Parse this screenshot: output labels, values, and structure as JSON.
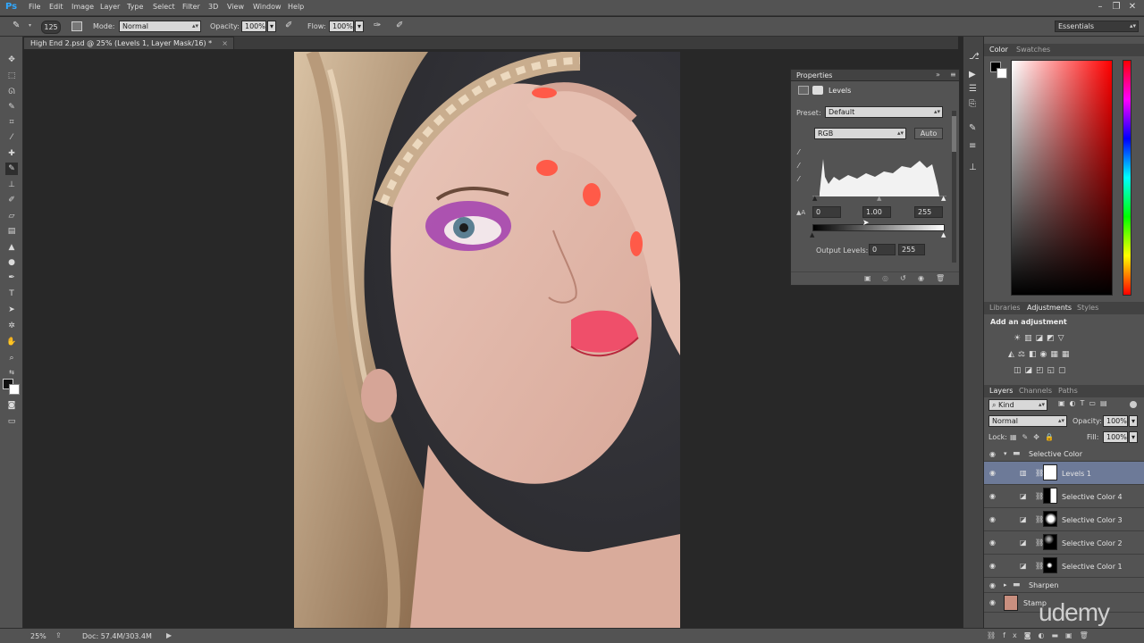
{
  "app": {
    "logo": "Ps"
  },
  "menu": [
    "File",
    "Edit",
    "Image",
    "Layer",
    "Type",
    "Select",
    "Filter",
    "3D",
    "View",
    "Window",
    "Help"
  ],
  "options_bar": {
    "brush_size": "125",
    "mode_label": "Mode:",
    "mode_value": "Normal",
    "opacity_label": "Opacity:",
    "opacity_value": "100%",
    "flow_label": "Flow:",
    "flow_value": "100%",
    "workspace": "Essentials"
  },
  "document_tab": {
    "title": "High End 2.psd @ 25% (Levels 1, Layer Mask/16) *",
    "close": "×"
  },
  "properties": {
    "panel_title": "Properties",
    "adjustment_name": "Levels",
    "preset_label": "Preset:",
    "preset_value": "Default",
    "channel_value": "RGB",
    "auto_label": "Auto",
    "input_black": "0",
    "input_gamma": "1.00",
    "input_white": "255",
    "output_label": "Output Levels:",
    "output_black": "0",
    "output_white": "255"
  },
  "color_panel": {
    "tabs": [
      "Color",
      "Swatches"
    ]
  },
  "adjustments_panel": {
    "tabs": [
      "Libraries",
      "Adjustments",
      "Styles"
    ],
    "hint": "Add an adjustment"
  },
  "layers_panel": {
    "tabs": [
      "Layers",
      "Channels",
      "Paths"
    ],
    "filter_kind": "Kind",
    "blend_mode": "Normal",
    "opacity_label": "Opacity:",
    "opacity_value": "100%",
    "lock_label": "Lock:",
    "fill_label": "Fill:",
    "fill_value": "100%",
    "group_name": "Selective Color",
    "layers": [
      {
        "name": "Levels 1"
      },
      {
        "name": "Selective Color 4"
      },
      {
        "name": "Selective Color 3"
      },
      {
        "name": "Selective Color 2"
      },
      {
        "name": "Selective Color 1"
      }
    ],
    "group2_name": "Sharpen",
    "stamp_name": "Stamp"
  },
  "status": {
    "zoom": "25%",
    "doc": "Doc: 57.4M/303.4M"
  },
  "watermark": "udemy"
}
